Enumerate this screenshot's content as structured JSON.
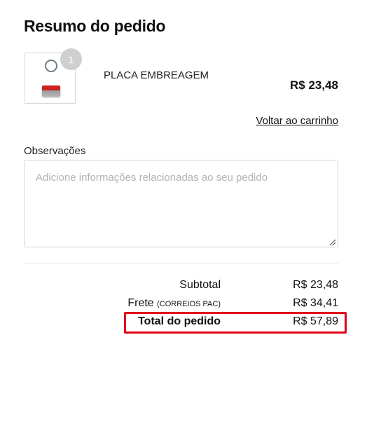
{
  "summary": {
    "title": "Resumo do pedido"
  },
  "item": {
    "quantity": "1",
    "name": "PLACA EMBREAGEM",
    "price": "R$ 23,48",
    "image_icon": "product-thumbnail"
  },
  "back_link": "Voltar ao carrinho",
  "notes": {
    "label": "Observações",
    "placeholder": "Adicione informações relacionadas ao seu pedido",
    "value": ""
  },
  "totals": {
    "subtotal_label": "Subtotal",
    "subtotal_value": "R$ 23,48",
    "shipping_label": "Frete",
    "shipping_method": "(CORREIOS PAC)",
    "shipping_value": "R$ 34,41",
    "total_label": "Total do pedido",
    "total_value": "R$ 57,89"
  },
  "colors": {
    "highlight": "#e0001b",
    "badge": "#cfcfcf"
  }
}
